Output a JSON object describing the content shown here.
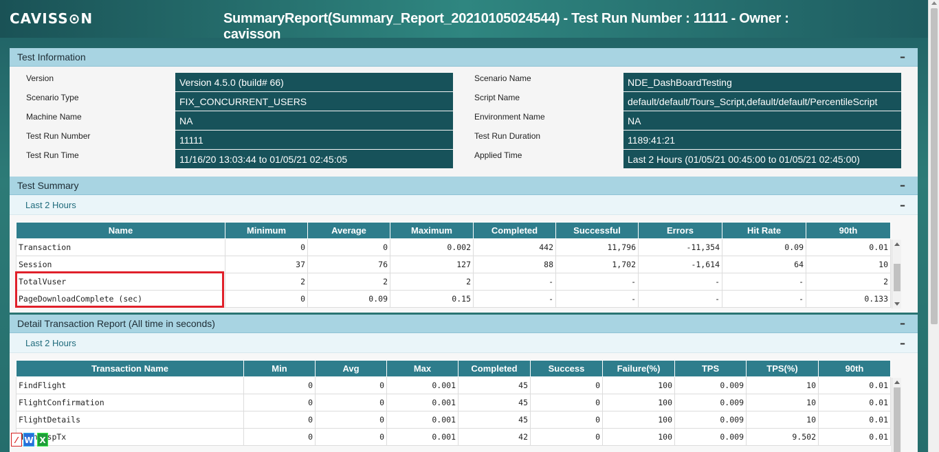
{
  "header": {
    "logo": "CAVISS⊙N",
    "title": "SummaryReport(Summary_Report_20210105024544) - Test Run Number : 11111 - Owner : cavisson"
  },
  "test_information": {
    "title": "Test Information",
    "collapse": "–",
    "left": [
      {
        "label": "Version",
        "value": "Version 4.5.0 (build# 66)"
      },
      {
        "label": "Scenario Type",
        "value": "FIX_CONCURRENT_USERS"
      },
      {
        "label": "Machine Name",
        "value": "NA"
      },
      {
        "label": "Test Run Number",
        "value": "11111"
      },
      {
        "label": "Test Run Time",
        "value": "11/16/20  13:03:44 to 01/05/21 02:45:05"
      }
    ],
    "right": [
      {
        "label": "Scenario Name",
        "value": "NDE_DashBoardTesting"
      },
      {
        "label": "Script Name",
        "value": "default/default/Tours_Script,default/default/PercentileScript"
      },
      {
        "label": "Environment Name",
        "value": "NA"
      },
      {
        "label": "Test Run Duration",
        "value": "1189:41:21"
      },
      {
        "label": "Applied Time",
        "value": "Last 2 Hours (01/05/21 00:45:00 to 01/05/21 02:45:00)"
      }
    ]
  },
  "test_summary": {
    "title": "Test Summary",
    "collapse": "–",
    "sub_title": "Last 2 Hours",
    "sub_collapse": "–",
    "columns": [
      "Name",
      "Minimum",
      "Average",
      "Maximum",
      "Completed",
      "Successful",
      "Errors",
      "Hit Rate",
      "90th"
    ],
    "rows": [
      [
        "Transaction",
        "0",
        "0",
        "0.002",
        "442",
        "11,796",
        "-11,354",
        "0.09",
        "0.01"
      ],
      [
        "Session",
        "37",
        "76",
        "127",
        "88",
        "1,702",
        "-1,614",
        "64",
        "10"
      ],
      [
        "TotalVuser",
        "2",
        "2",
        "2",
        "-",
        "-",
        "-",
        "-",
        "2"
      ],
      [
        "PageDownloadComplete (sec)",
        "0",
        "0.09",
        "0.15",
        "-",
        "-",
        "-",
        "-",
        "0.133"
      ]
    ]
  },
  "detail_transaction": {
    "title": "Detail Transaction Report (All time in seconds)",
    "collapse": "–",
    "sub_title": "Last 2 Hours",
    "sub_collapse": "–",
    "columns": [
      "Transaction Name",
      "Min",
      "Avg",
      "Max",
      "Completed",
      "Success",
      "Failure(%)",
      "TPS",
      "TPS(%)",
      "90th"
    ],
    "rows": [
      [
        "FindFlight",
        "0",
        "0",
        "0.001",
        "45",
        "0",
        "100",
        "0.009",
        "10",
        "0.01"
      ],
      [
        "FlightConfirmation",
        "0",
        "0",
        "0.001",
        "45",
        "0",
        "100",
        "0.009",
        "10",
        "0.01"
      ],
      [
        "FlightDetails",
        "0",
        "0",
        "0.001",
        "45",
        "0",
        "100",
        "0.009",
        "10",
        "0.01"
      ],
      [
        "HighRespTx",
        "0",
        "0",
        "0.001",
        "42",
        "0",
        "100",
        "0.009",
        "9.502",
        "0.01"
      ]
    ]
  },
  "export": {
    "pdf_icon": "pdf-icon",
    "word_icon": "word-icon",
    "excel_icon": "excel-icon",
    "pdf_glyph": "⁄",
    "word_glyph": "W",
    "excel_glyph": "X"
  }
}
